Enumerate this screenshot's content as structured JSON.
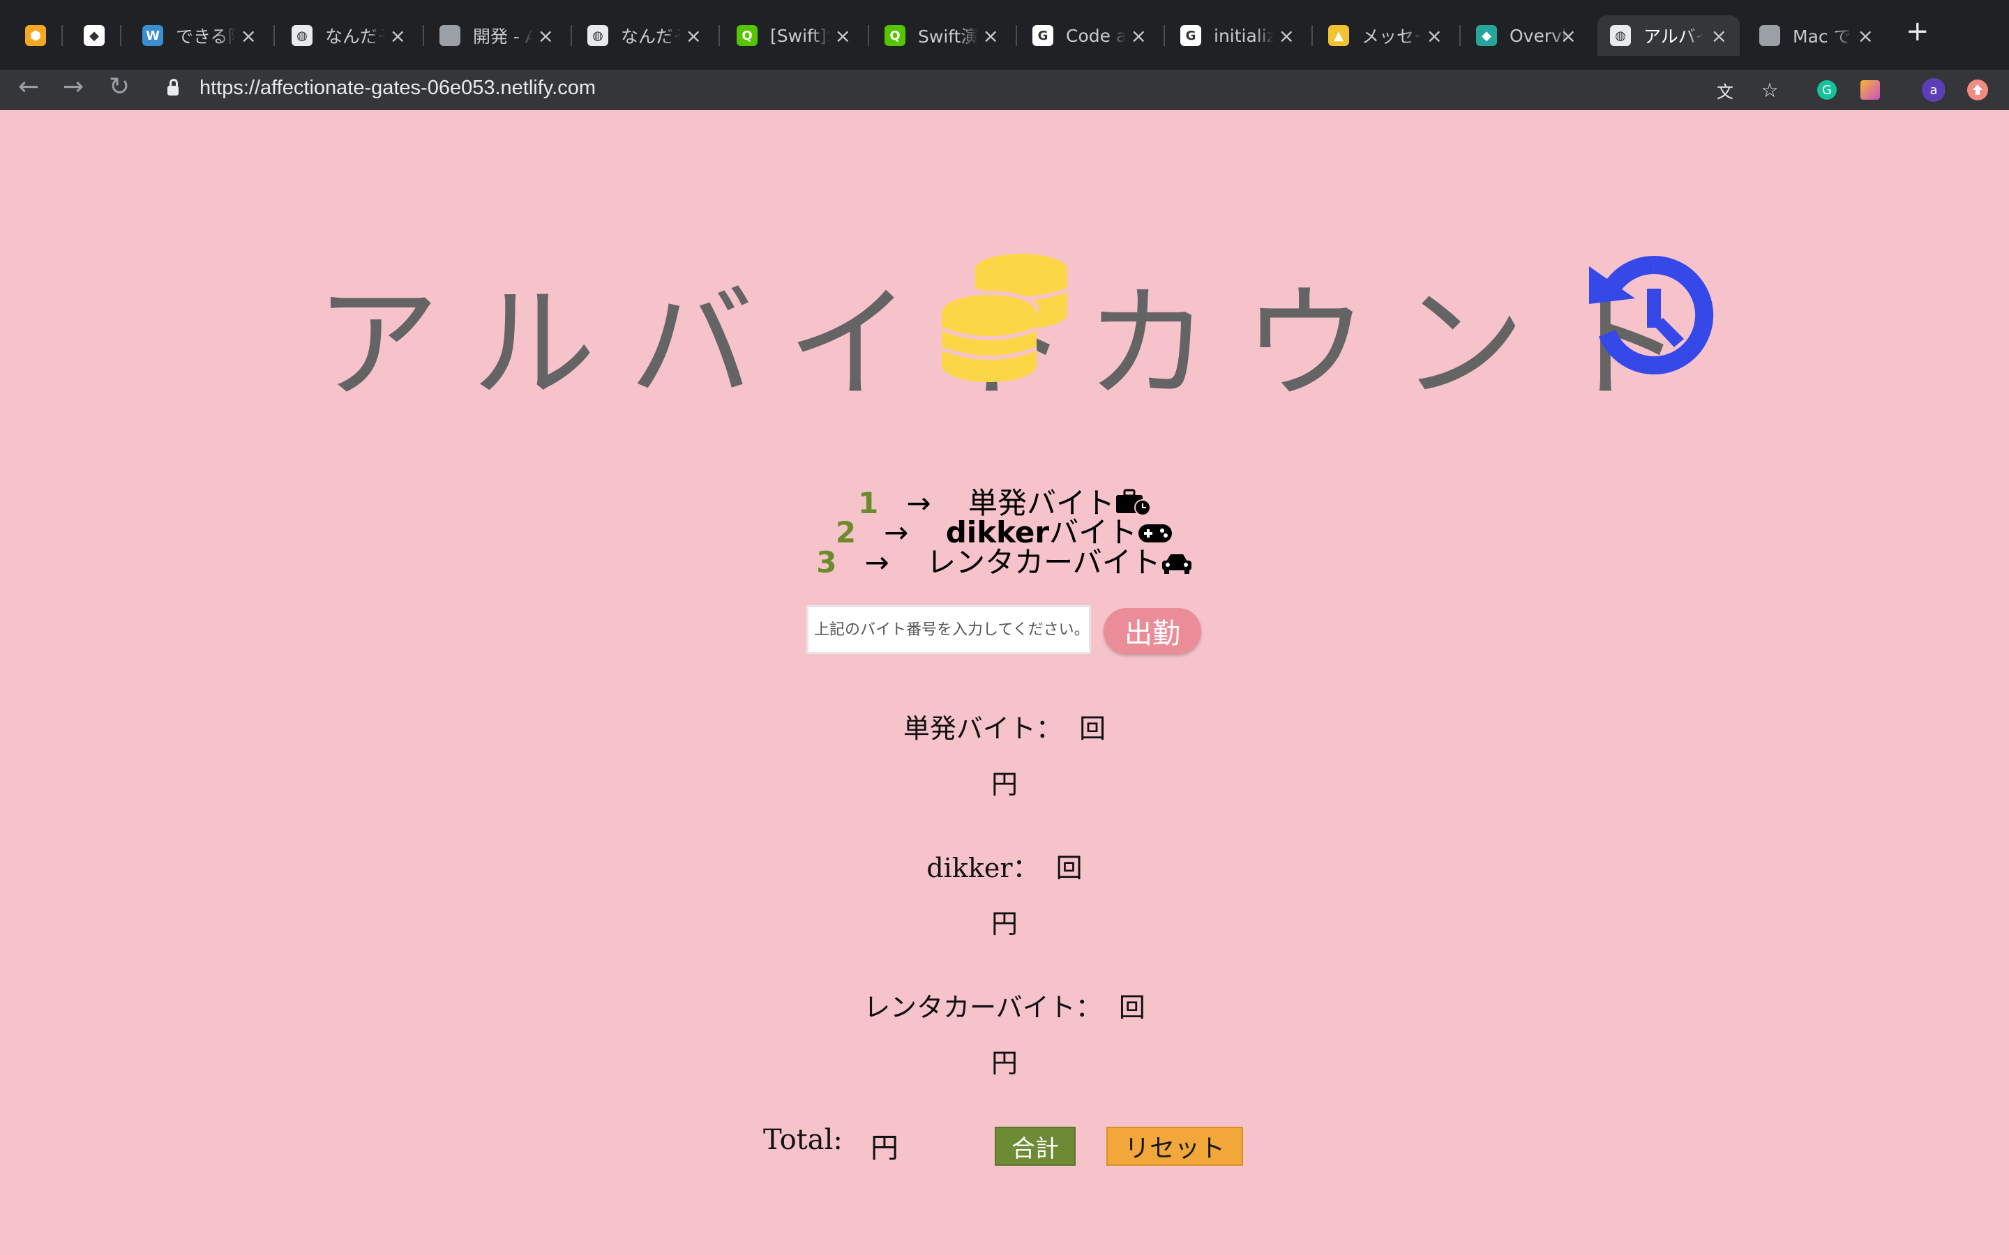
{
  "browser": {
    "tabs": [
      {
        "title": "",
        "fav_color": "#f5a623",
        "fav_glyph": "⬢"
      },
      {
        "title": "",
        "fav_color": "#ffffff",
        "fav_glyph": "◆"
      },
      {
        "title": "できる限",
        "fav_color": "#3a8fd1",
        "fav_glyph": "W"
      },
      {
        "title": "なんだそ",
        "fav_color": "#e8eaed",
        "fav_glyph": "◍"
      },
      {
        "title": "開発 - A",
        "fav_color": "#9aa0a6",
        "fav_glyph": ""
      },
      {
        "title": "なんだそ",
        "fav_color": "#e8eaed",
        "fav_glyph": "◍"
      },
      {
        "title": "[Swift]S",
        "fav_color": "#55c500",
        "fav_glyph": "Q"
      },
      {
        "title": "Swift演",
        "fav_color": "#55c500",
        "fav_glyph": "Q"
      },
      {
        "title": "Code ar",
        "fav_color": "#ffffff",
        "fav_glyph": "G"
      },
      {
        "title": "initializ",
        "fav_color": "#ffffff",
        "fav_glyph": "G"
      },
      {
        "title": "メッセー",
        "fav_color": "#f2c230",
        "fav_glyph": "▲"
      },
      {
        "title": "Overvie",
        "fav_color": "#26a69a",
        "fav_glyph": "◆"
      },
      {
        "title": "アルバイ",
        "fav_color": "#e8eaed",
        "fav_glyph": "◍"
      },
      {
        "title": "Mac で",
        "fav_color": "#9aa0a6",
        "fav_glyph": ""
      }
    ],
    "url": "https://affectionate-gates-06e053.netlify.com",
    "avatar_letter": "a"
  },
  "page": {
    "title_left": "アルバイト",
    "title_right": "カウント",
    "menu": [
      {
        "num": "1",
        "arrow": "→",
        "pre": "",
        "label": "単発バイト",
        "icon": "briefcase-clock-icon"
      },
      {
        "num": "2",
        "arrow": "→",
        "pre": "dikker",
        "label": "バイト",
        "icon": "gamepad-icon"
      },
      {
        "num": "3",
        "arrow": "→",
        "pre": "",
        "label": "レンタカーバイト",
        "icon": "car-icon"
      }
    ],
    "input_placeholder": "上記のバイト番号を入力してください。",
    "work_button": "出勤",
    "stats": [
      {
        "label": "単発バイト：",
        "count_unit": "回",
        "yen_unit": "円"
      },
      {
        "label": "dikker：",
        "count_unit": "回",
        "yen_unit": "円"
      },
      {
        "label": "レンタカーバイト：",
        "count_unit": "回",
        "yen_unit": "円"
      }
    ],
    "total_label": "Total:",
    "total_unit": "円",
    "sum_button": "合計",
    "reset_button": "リセット"
  },
  "colors": {
    "background": "#f6c3cb",
    "title_gray": "#646464",
    "coin_yellow": "#fbd747",
    "history_blue": "#3548e8",
    "number_green": "#6b8b2c",
    "work_button": "#ea8d98",
    "sum_button": "#6c8b34",
    "reset_button": "#f2a73a"
  }
}
